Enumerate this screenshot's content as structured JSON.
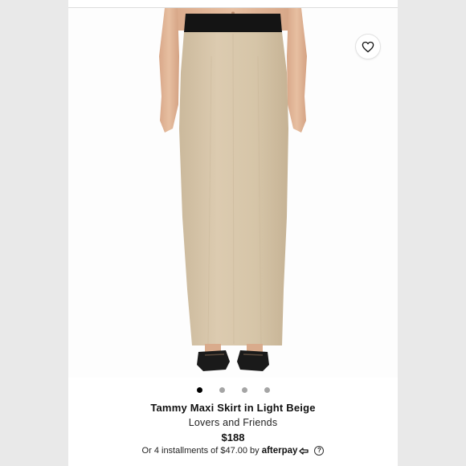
{
  "product": {
    "title": "Tammy Maxi Skirt in Light Beige",
    "brand": "Lovers and Friends",
    "price": "$188"
  },
  "installments": {
    "text": "Or 4 installments of $47.00 by",
    "provider": "afterpay",
    "help_glyph": "?"
  },
  "carousel": {
    "total": 4,
    "active_index": 0
  },
  "icons": {
    "favorite": "heart-icon",
    "help": "question-circle-icon",
    "afterpay_logo": "afterpay-arrows-icon"
  },
  "colors": {
    "skirt": "#d7c6aa",
    "waistband": "#111111",
    "accent": "#000000"
  }
}
